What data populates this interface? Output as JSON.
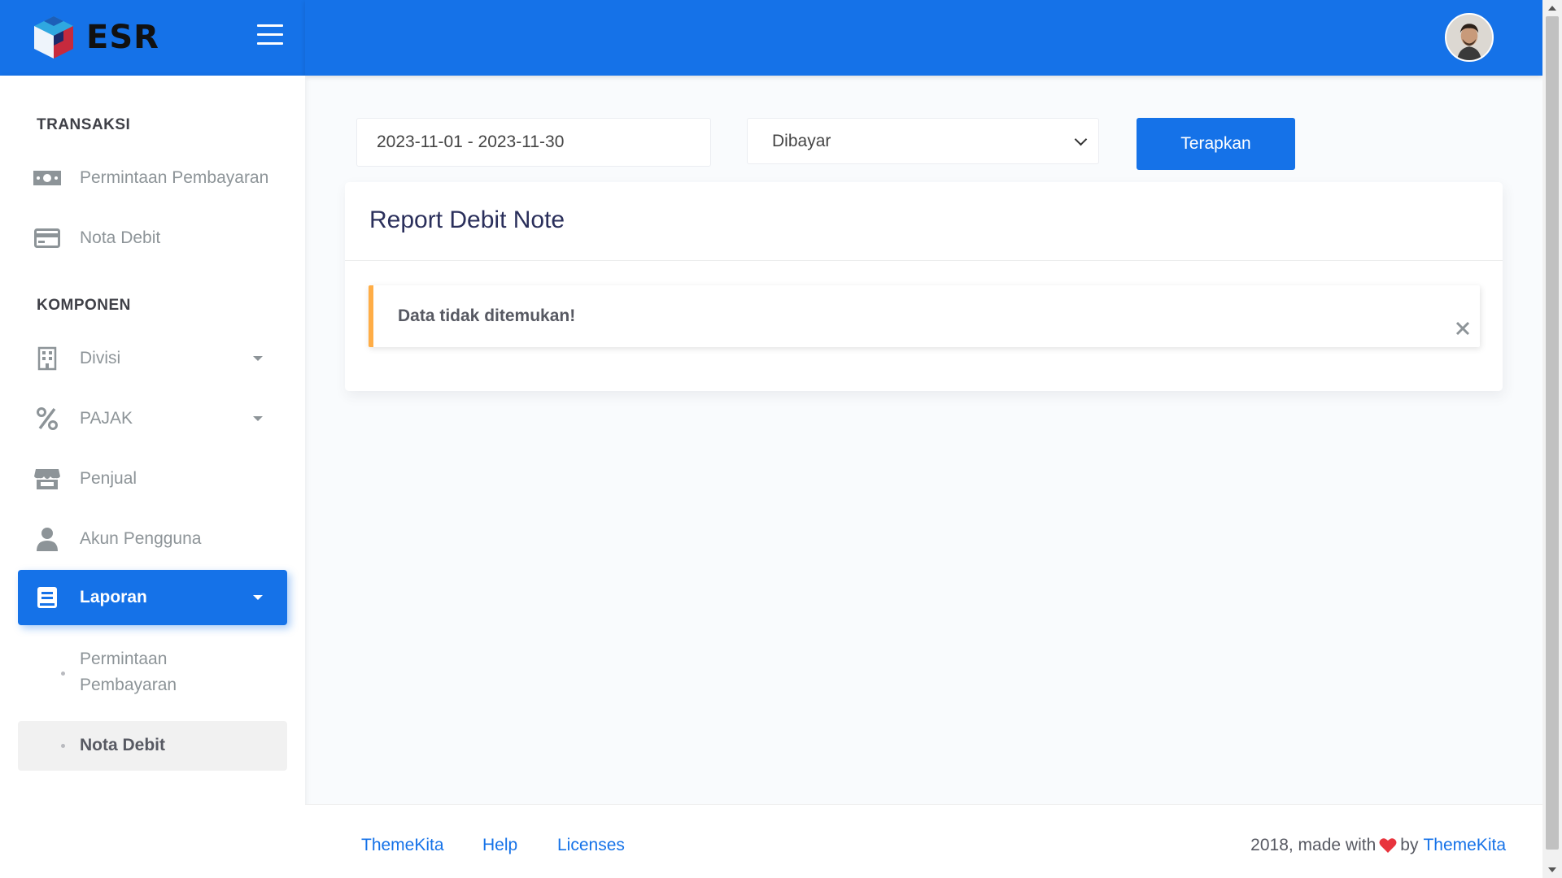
{
  "header": {
    "logo_text": "ESR",
    "accent_color": "#1572e8"
  },
  "sidebar": {
    "sections": [
      {
        "label": "TRANSAKSI"
      },
      {
        "label": "KOMPONEN"
      }
    ],
    "items": [
      {
        "label": "Permintaan Pembayaran",
        "icon": "money-icon"
      },
      {
        "label": "Nota Debit",
        "icon": "credit-card-icon"
      },
      {
        "label": "Divisi",
        "icon": "building-icon"
      },
      {
        "label": "PAJAK",
        "icon": "percent-icon"
      },
      {
        "label": "Penjual",
        "icon": "store-icon"
      },
      {
        "label": "Akun Pengguna",
        "icon": "user-icon"
      },
      {
        "label": "Laporan",
        "icon": "book-icon"
      }
    ],
    "sub_items": [
      {
        "label_line1": "Permintaan",
        "label_line2": "Pembayaran"
      },
      {
        "label": "Nota Debit"
      }
    ]
  },
  "filters": {
    "date_range": "2023-11-01 - 2023-11-30",
    "status_selected": "Dibayar",
    "apply_label": "Terapkan"
  },
  "card": {
    "title": "Report Debit Note",
    "alert_message": "Data tidak ditemukan!",
    "alert_color": "#ffad46"
  },
  "footer": {
    "links": [
      "ThemeKita",
      "Help",
      "Licenses"
    ],
    "copy_prefix": "2018, made with",
    "copy_by": "by",
    "copy_brand": "ThemeKita",
    "heart_color": "#e8343d"
  }
}
